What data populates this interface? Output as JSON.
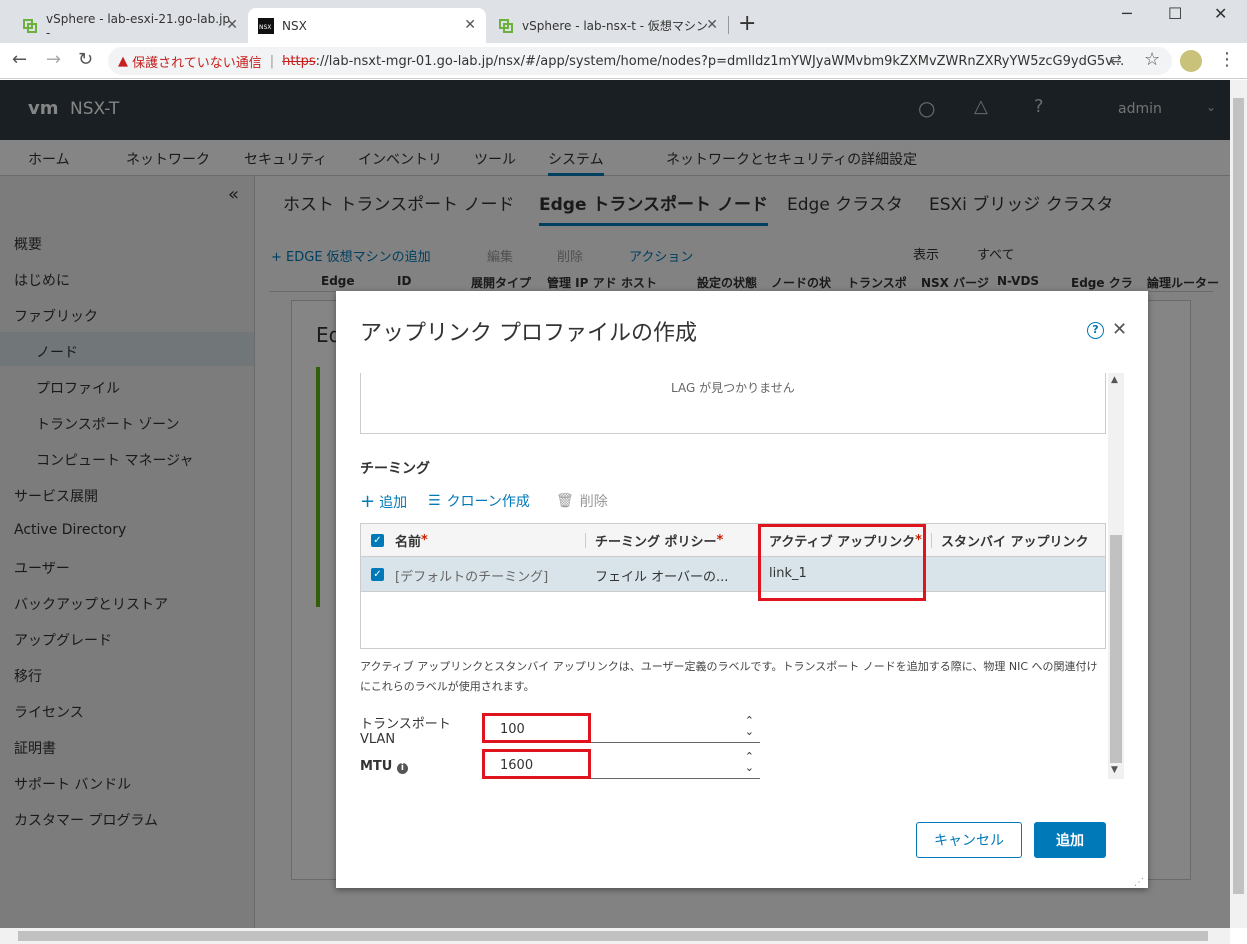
{
  "browser": {
    "tabs": [
      {
        "title": "vSphere - lab-esxi-21.go-lab.jp -",
        "active": false
      },
      {
        "title": "NSX",
        "active": true
      },
      {
        "title": "vSphere - lab-nsx-t - 仮想マシン",
        "active": false
      }
    ],
    "new_tab_label": "+",
    "address": {
      "security_label": "保護されていない通信",
      "scheme": "https",
      "rest": "://lab-nsxt-mgr-01.go-lab.jp/nsx/#/app/system/home/nodes?p=dmlldz1mYWJyaWMvbm9kZXMvZWRnZXRyYW5zcG9ydG5v..."
    }
  },
  "app": {
    "logo": "vm",
    "product": "NSX-T",
    "user": "admin",
    "nav_tabs": [
      "ホーム",
      "ネットワーク",
      "セキュリティ",
      "インベントリ",
      "ツール",
      "システム",
      "ネットワークとセキュリティの詳細設定"
    ],
    "collapse_icon": "«",
    "sidebar": [
      "概要",
      "はじめに",
      "ファブリック",
      "ノード",
      "プロファイル",
      "トランスポート ゾーン",
      "コンピュート マネージャ",
      "サービス展開",
      "Active Directory",
      "ユーザー",
      "バックアップとリストア",
      "アップグレード",
      "移行",
      "ライセンス",
      "証明書",
      "サポート バンドル",
      "カスタマー プログラム"
    ],
    "subtabs": [
      "ホスト トランスポート ノード",
      "Edge トランスポート ノード",
      "Edge クラスタ",
      "ESXi ブリッジ クラスタ"
    ],
    "toolbar": {
      "add": "+ EDGE 仮想マシンの追加",
      "edit": "編集",
      "delete": "削除",
      "actions": "アクション",
      "view_label": "表示",
      "view_value": "すべて"
    },
    "table_headers": [
      "Edge",
      "ID",
      "展開タイプ",
      "管理 IP アド",
      "ホスト",
      "設定の状態",
      "ノードの状",
      "トランスポ",
      "NSX バージ",
      "N-VDS",
      "Edge クラ",
      "論理ルーター"
    ],
    "bg_card_letter": "Ed"
  },
  "modal": {
    "title": "アップリンク プロファイルの作成",
    "lag_empty": "LAG が見つかりません",
    "teaming_section": "チーミング",
    "actions": {
      "add": "追加",
      "clone": "クローン作成",
      "delete": "削除"
    },
    "grid": {
      "headers": [
        "名前",
        "チーミング ポリシー",
        "アクティブ アップリンク",
        "スタンバイ アップリンク"
      ],
      "required_mark": "*",
      "rows": [
        {
          "name": "[デフォルトのチーミング]",
          "policy": "フェイル オーバーの...",
          "active": "link_1",
          "standby": ""
        }
      ]
    },
    "help_text": "アクティブ アップリンクとスタンバイ アップリンクは、ユーザー定義のラベルです。トランスポート ノードを追加する際に、物理 NIC への関連付けにこれらのラベルが使用されます。",
    "fields": {
      "transport_vlan_label_1": "トランスポート",
      "transport_vlan_label_2": "VLAN",
      "transport_vlan_value": "100",
      "mtu_label": "MTU",
      "mtu_value": "1600"
    },
    "cancel_label": "キャンセル",
    "add_label": "追加"
  },
  "colors": {
    "accent": "#0079b8",
    "highlight": "#e0141e",
    "header": "#313c42"
  }
}
